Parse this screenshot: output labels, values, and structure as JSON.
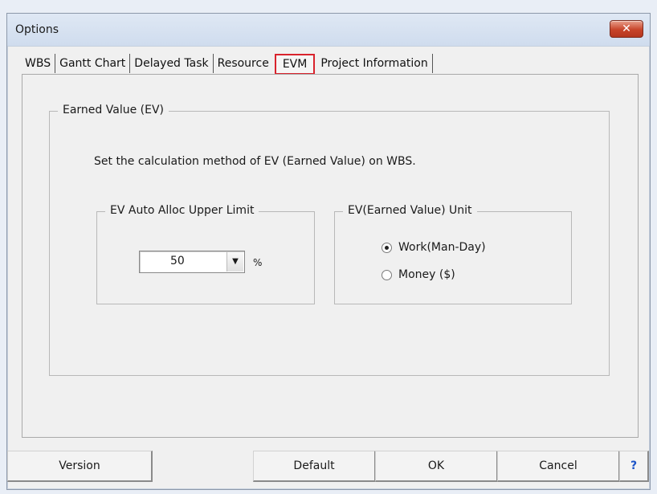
{
  "window": {
    "title": "Options",
    "close_icon": "close-icon"
  },
  "tabs": [
    {
      "label": "WBS",
      "active": false
    },
    {
      "label": "Gantt Chart",
      "active": false
    },
    {
      "label": "Delayed Task",
      "active": false
    },
    {
      "label": "Resource",
      "active": false
    },
    {
      "label": "EVM",
      "active": true
    },
    {
      "label": "Project Information",
      "active": false
    }
  ],
  "ev_group": {
    "legend": "Earned Value (EV)",
    "description": "Set the calculation method of EV (Earned Value) on WBS."
  },
  "upper_limit": {
    "legend": "EV Auto Alloc Upper Limit",
    "value": "50",
    "unit": "%"
  },
  "unit_group": {
    "legend": "EV(Earned Value) Unit",
    "options": [
      {
        "label": "Work(Man-Day)",
        "checked": true
      },
      {
        "label": "Money ($)",
        "checked": false
      }
    ]
  },
  "buttons": {
    "version": "Version",
    "default": "Default",
    "ok": "OK",
    "cancel": "Cancel",
    "help": "?"
  },
  "colors": {
    "highlight": "#d9232d",
    "close": "#c7442a",
    "help": "#1c54c8"
  }
}
